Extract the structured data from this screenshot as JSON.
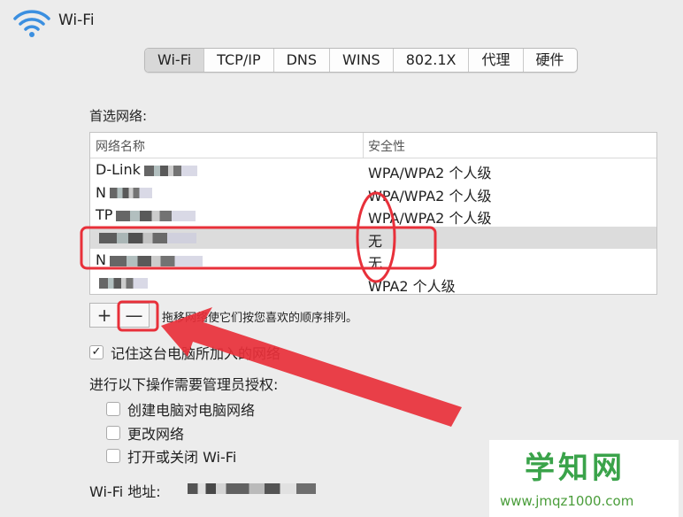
{
  "window": {
    "title": "Wi-Fi"
  },
  "tabs": [
    "Wi-Fi",
    "TCP/IP",
    "DNS",
    "WINS",
    "802.1X",
    "代理",
    "硬件"
  ],
  "active_tab": "Wi-Fi",
  "preferred": {
    "label": "首选网络:",
    "columns": [
      "网络名称",
      "安全性"
    ],
    "rows": [
      {
        "name": "D-Link",
        "security": "WPA/WPA2 个人级"
      },
      {
        "name": "N",
        "security": "WPA/WPA2 个人级"
      },
      {
        "name": "TP",
        "security": "WPA/WPA2 个人级"
      },
      {
        "name": "",
        "security": "无"
      },
      {
        "name": "N",
        "security": "无"
      },
      {
        "name": "",
        "security": "WPA2 个人级"
      }
    ]
  },
  "buttons": {
    "add": "+",
    "remove": "—"
  },
  "hint": "拖移网络使它们按您喜欢的顺序排列。",
  "remember": {
    "label": "记住这台电脑所加入的网络",
    "checked": true,
    "mark": "✓"
  },
  "admin": {
    "label": "进行以下操作需要管理员授权:",
    "options": [
      "创建电脑对电脑网络",
      "更改网络",
      "打开或关闭 Wi-Fi"
    ]
  },
  "mac": {
    "label": "Wi-Fi 地址:"
  },
  "watermark": {
    "name": "学知网",
    "url": "www.jmqz1000.com"
  },
  "colors": {
    "annotation": "#e8303a",
    "watermark_green": "#3aa34a"
  }
}
